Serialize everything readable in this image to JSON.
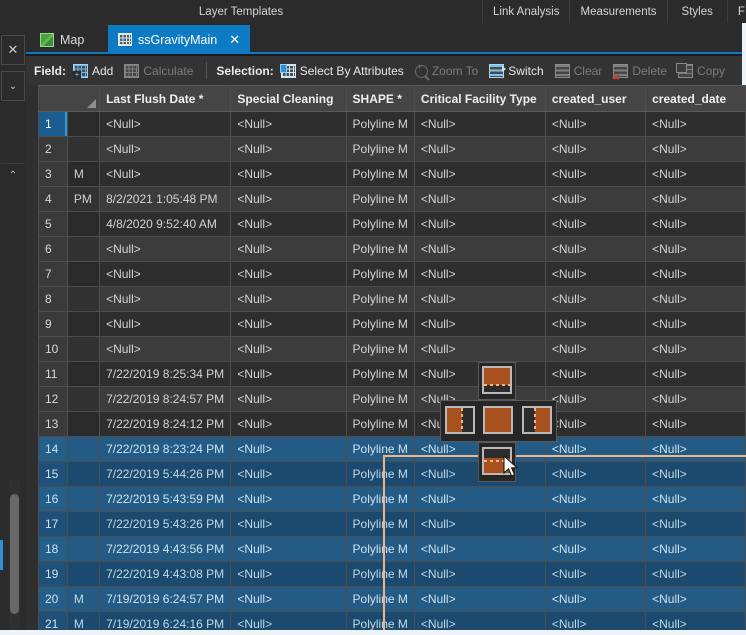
{
  "topbar": {
    "center_label": "Layer Templates",
    "menus": [
      {
        "label": "Link Analysis"
      },
      {
        "label": "Measurements"
      },
      {
        "label": "Styles"
      },
      {
        "label": "F"
      }
    ]
  },
  "leftstrip": {
    "close_label": "✕",
    "chevron_down_label": "⌄",
    "chevron_up_label": "⌃"
  },
  "tabs": [
    {
      "label": "Map",
      "icon": "map-icon",
      "active": false
    },
    {
      "label": "ssGravityMain",
      "icon": "table-grid-icon",
      "active": true,
      "close_label": "✕"
    }
  ],
  "ribbon": {
    "field_label": "Field:",
    "field_items": [
      {
        "label": "Add",
        "icon": "table-add-icon",
        "enabled": true
      },
      {
        "label": "Calculate",
        "icon": "table-calculate-icon",
        "enabled": false
      }
    ],
    "selection_label": "Selection:",
    "selection_items": [
      {
        "label": "Select By Attributes",
        "icon": "select-by-attributes-icon",
        "enabled": true
      },
      {
        "label": "Zoom To",
        "icon": "zoom-to-icon",
        "enabled": false
      },
      {
        "label": "Switch",
        "icon": "switch-selection-icon",
        "enabled": true
      },
      {
        "label": "Clear",
        "icon": "clear-selection-icon",
        "enabled": false
      },
      {
        "label": "Delete",
        "icon": "delete-selection-icon",
        "enabled": false
      },
      {
        "label": "Copy",
        "icon": "copy-selection-icon",
        "enabled": false
      }
    ]
  },
  "table": {
    "columns": [
      {
        "key": "rownum",
        "label": ""
      },
      {
        "key": "clip",
        "label": ""
      },
      {
        "key": "flush",
        "label": "Last Flush Date *"
      },
      {
        "key": "spec",
        "label": "Special Cleaning"
      },
      {
        "key": "shape",
        "label": "SHAPE *"
      },
      {
        "key": "crit",
        "label": "Critical Facility Type"
      },
      {
        "key": "user",
        "label": "created_user"
      },
      {
        "key": "date",
        "label": "created_date"
      }
    ],
    "null_text": "<Null>",
    "rows": [
      {
        "num": "1",
        "clip": "",
        "flush": "<Null>",
        "spec": "<Null>",
        "shape": "Polyline M",
        "crit": "<Null>",
        "user": "<Null>",
        "date": "<Null>",
        "selected": false,
        "active": true
      },
      {
        "num": "2",
        "clip": "",
        "flush": "<Null>",
        "spec": "<Null>",
        "shape": "Polyline M",
        "crit": "<Null>",
        "user": "<Null>",
        "date": "<Null>",
        "selected": false,
        "active": false
      },
      {
        "num": "3",
        "clip": "M",
        "flush": "<Null>",
        "spec": "<Null>",
        "shape": "Polyline M",
        "crit": "<Null>",
        "user": "<Null>",
        "date": "<Null>",
        "selected": false,
        "active": false
      },
      {
        "num": "4",
        "clip": "PM",
        "flush": "8/2/2021 1:05:48 PM",
        "spec": "<Null>",
        "shape": "Polyline M",
        "crit": "<Null>",
        "user": "<Null>",
        "date": "<Null>",
        "selected": false,
        "active": false
      },
      {
        "num": "5",
        "clip": "",
        "flush": "4/8/2020 9:52:40 AM",
        "spec": "<Null>",
        "shape": "Polyline M",
        "crit": "<Null>",
        "user": "<Null>",
        "date": "<Null>",
        "selected": false,
        "active": false
      },
      {
        "num": "6",
        "clip": "",
        "flush": "<Null>",
        "spec": "<Null>",
        "shape": "Polyline M",
        "crit": "<Null>",
        "user": "<Null>",
        "date": "<Null>",
        "selected": false,
        "active": false
      },
      {
        "num": "7",
        "clip": "",
        "flush": "<Null>",
        "spec": "<Null>",
        "shape": "Polyline M",
        "crit": "<Null>",
        "user": "<Null>",
        "date": "<Null>",
        "selected": false,
        "active": false
      },
      {
        "num": "8",
        "clip": "",
        "flush": "<Null>",
        "spec": "<Null>",
        "shape": "Polyline M",
        "crit": "<Null>",
        "user": "<Null>",
        "date": "<Null>",
        "selected": false,
        "active": false
      },
      {
        "num": "9",
        "clip": "",
        "flush": "<Null>",
        "spec": "<Null>",
        "shape": "Polyline M",
        "crit": "<Null>",
        "user": "<Null>",
        "date": "<Null>",
        "selected": false,
        "active": false
      },
      {
        "num": "10",
        "clip": "",
        "flush": "<Null>",
        "spec": "<Null>",
        "shape": "Polyline M",
        "crit": "<Null>",
        "user": "<Null>",
        "date": "<Null>",
        "selected": false,
        "active": false
      },
      {
        "num": "11",
        "clip": "",
        "flush": "7/22/2019 8:25:34 PM",
        "spec": "<Null>",
        "shape": "Polyline M",
        "crit": "<Null>",
        "user": "<Null>",
        "date": "<Null>",
        "selected": false,
        "active": false
      },
      {
        "num": "12",
        "clip": "",
        "flush": "7/22/2019 8:24:57 PM",
        "spec": "<Null>",
        "shape": "Polyline M",
        "crit": "<Null>",
        "user": "<Null>",
        "date": "<Null>",
        "selected": false,
        "active": false
      },
      {
        "num": "13",
        "clip": "",
        "flush": "7/22/2019 8:24:12 PM",
        "spec": "<Null>",
        "shape": "Polyline M",
        "crit": "<Null>",
        "user": "<Null>",
        "date": "<Null>",
        "selected": false,
        "active": false
      },
      {
        "num": "14",
        "clip": "",
        "flush": "7/22/2019 8:23:24 PM",
        "spec": "<Null>",
        "shape": "Polyline M",
        "crit": "<Null>",
        "user": "<Null>",
        "date": "<Null>",
        "selected": true,
        "active": false
      },
      {
        "num": "15",
        "clip": "",
        "flush": "7/22/2019 5:44:26 PM",
        "spec": "<Null>",
        "shape": "Polyline M",
        "crit": "<Null>",
        "user": "<Null>",
        "date": "<Null>",
        "selected": true,
        "active": false
      },
      {
        "num": "16",
        "clip": "",
        "flush": "7/22/2019 5:43:59 PM",
        "spec": "<Null>",
        "shape": "Polyline M",
        "crit": "<Null>",
        "user": "<Null>",
        "date": "<Null>",
        "selected": true,
        "active": false
      },
      {
        "num": "17",
        "clip": "",
        "flush": "7/22/2019 5:43:26 PM",
        "spec": "<Null>",
        "shape": "Polyline M",
        "crit": "<Null>",
        "user": "<Null>",
        "date": "<Null>",
        "selected": true,
        "active": false
      },
      {
        "num": "18",
        "clip": "",
        "flush": "7/22/2019 4:43:56 PM",
        "spec": "<Null>",
        "shape": "Polyline M",
        "crit": "<Null>",
        "user": "<Null>",
        "date": "<Null>",
        "selected": true,
        "active": false
      },
      {
        "num": "19",
        "clip": "",
        "flush": "7/22/2019 4:43:08 PM",
        "spec": "<Null>",
        "shape": "Polyline M",
        "crit": "<Null>",
        "user": "<Null>",
        "date": "<Null>",
        "selected": true,
        "active": false
      },
      {
        "num": "20",
        "clip": "M",
        "flush": "7/19/2019 6:24:57 PM",
        "spec": "<Null>",
        "shape": "Polyline M",
        "crit": "<Null>",
        "user": "<Null>",
        "date": "<Null>",
        "selected": true,
        "active": false
      },
      {
        "num": "21",
        "clip": "M",
        "flush": "7/19/2019 6:24:16 PM",
        "spec": "<Null>",
        "shape": "Polyline M",
        "crit": "<Null>",
        "user": "<Null>",
        "date": "<Null>",
        "selected": true,
        "active": false
      }
    ]
  },
  "dock_guide": {
    "targets": [
      {
        "name": "dock-top",
        "position": "top"
      },
      {
        "name": "dock-left",
        "position": "left"
      },
      {
        "name": "dock-center",
        "position": "center"
      },
      {
        "name": "dock-right",
        "position": "right"
      },
      {
        "name": "dock-bottom",
        "position": "bottom"
      }
    ],
    "accent_color": "#a8501e",
    "outline_color": "#f0b48a"
  }
}
